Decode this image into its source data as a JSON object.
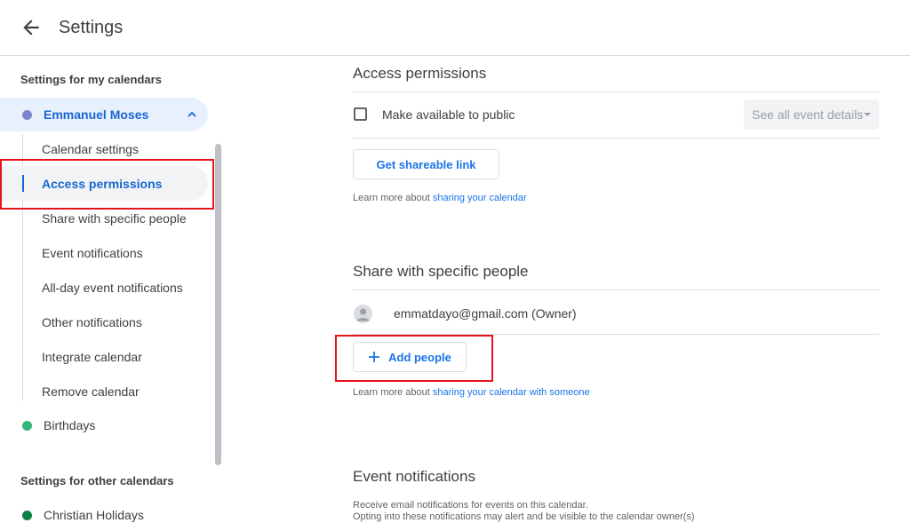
{
  "header": {
    "title": "Settings"
  },
  "sidebar": {
    "my_calendars_title": "Settings for my calendars",
    "my_calendar": {
      "name": "Emmanuel Moses",
      "color": "#7986cb"
    },
    "sub_items": [
      {
        "label": "Calendar settings"
      },
      {
        "label": "Access permissions"
      },
      {
        "label": "Share with specific people"
      },
      {
        "label": "Event notifications"
      },
      {
        "label": "All-day event notifications"
      },
      {
        "label": "Other notifications"
      },
      {
        "label": "Integrate calendar"
      },
      {
        "label": "Remove calendar"
      }
    ],
    "birthdays": {
      "name": "Birthdays",
      "color": "#33b679"
    },
    "other_calendars_title": "Settings for other calendars",
    "holidays": {
      "name": "Christian Holidays",
      "color": "#0b8043"
    }
  },
  "access": {
    "title": "Access permissions",
    "make_public_label": "Make available to public",
    "select_value": "See all event details",
    "shareable_button": "Get shareable link",
    "learn_prefix": "Learn more about ",
    "learn_link": "sharing your calendar"
  },
  "share": {
    "title": "Share with specific people",
    "owner": "emmatdayo@gmail.com (Owner)",
    "add_people": "Add people",
    "learn_prefix": "Learn more about ",
    "learn_link": "sharing your calendar with someone"
  },
  "notifications": {
    "title": "Event notifications",
    "line1": "Receive email notifications for events on this calendar.",
    "line2": "Opting into these notifications may alert and be visible to the calendar owner(s)"
  },
  "colors": {
    "accent": "#1a73e8",
    "highlight": "#e8141c"
  }
}
